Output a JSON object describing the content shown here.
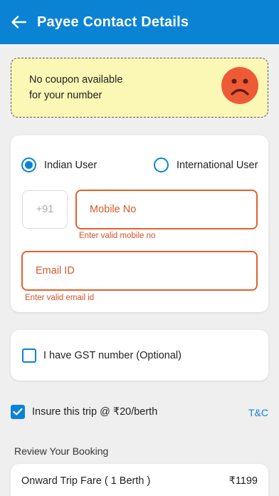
{
  "header": {
    "title": "Payee Contact Details",
    "back_icon": "arrow-left-icon"
  },
  "coupon_banner": {
    "line1": "No coupon available",
    "line2": "for your number",
    "icon": "sad-face-icon",
    "icon_color": "#ef5a36",
    "background": "#fbf7b5"
  },
  "contact_form": {
    "user_type_options": [
      {
        "label": "Indian User",
        "selected": true
      },
      {
        "label": "International User",
        "selected": false
      }
    ],
    "country_code": "+91",
    "mobile": {
      "placeholder": "Mobile No",
      "value": "",
      "error": "Enter valid mobile no"
    },
    "email": {
      "placeholder": "Email ID",
      "value": "",
      "error": "Enter valid email id"
    }
  },
  "gst": {
    "label": "I have GST number (Optional)",
    "checked": false
  },
  "insurance": {
    "label": "Insure this trip @ ₹20/berth",
    "checked": true,
    "terms_link": "T&C"
  },
  "review": {
    "title": "Review Your Booking",
    "fare_label": "Onward Trip Fare ( 1 Berth )",
    "fare_amount": "₹1199"
  },
  "colors": {
    "primary": "#0b83d4",
    "error": "#e5602d",
    "background": "#efefef"
  }
}
